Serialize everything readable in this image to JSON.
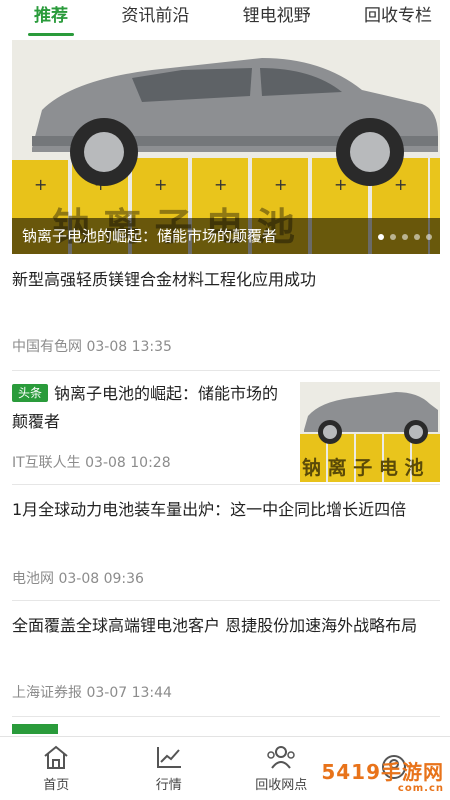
{
  "tabs": [
    {
      "label": "推荐",
      "active": true
    },
    {
      "label": "资讯前沿",
      "active": false
    },
    {
      "label": "锂电视野",
      "active": false
    },
    {
      "label": "回收专栏",
      "active": false
    }
  ],
  "banner": {
    "caption": "钠离子电池的崛起：储能市场的颠覆者",
    "image_text": "钠 离 子 电 池",
    "dots_count": 5,
    "active_dot": 0
  },
  "feed": [
    {
      "title": "新型高强轻质镁锂合金材料工程化应用成功",
      "source": "中国有色网",
      "time": "03-08 13:35"
    },
    {
      "badge": "头条",
      "title": "钠离子电池的崛起：储能市场的颠覆者",
      "source": "IT互联人生",
      "time": "03-08 10:28",
      "thumb_text": "钠 离 子 电 池"
    },
    {
      "title": "1月全球动力电池装车量出炉：这一中企同比增长近四倍",
      "source": "电池网",
      "time": "03-08 09:36"
    },
    {
      "title": "全面覆盖全球高端锂电池客户 恩捷股份加速海外战略布局",
      "source": "上海证券报",
      "time": "03-07 13:44"
    }
  ],
  "bottom_nav": [
    {
      "label": "首页",
      "icon": "home-icon"
    },
    {
      "label": "行情",
      "icon": "chart-icon"
    },
    {
      "label": "回收网点",
      "icon": "people-icon"
    },
    {
      "label": "",
      "icon": "user-icon"
    }
  ],
  "watermark": {
    "main": "5419手游网",
    "sub": "com.cn"
  },
  "colors": {
    "accent": "#2a9b3b",
    "meta": "#8c8c8c",
    "battery": "#e8c21a"
  }
}
